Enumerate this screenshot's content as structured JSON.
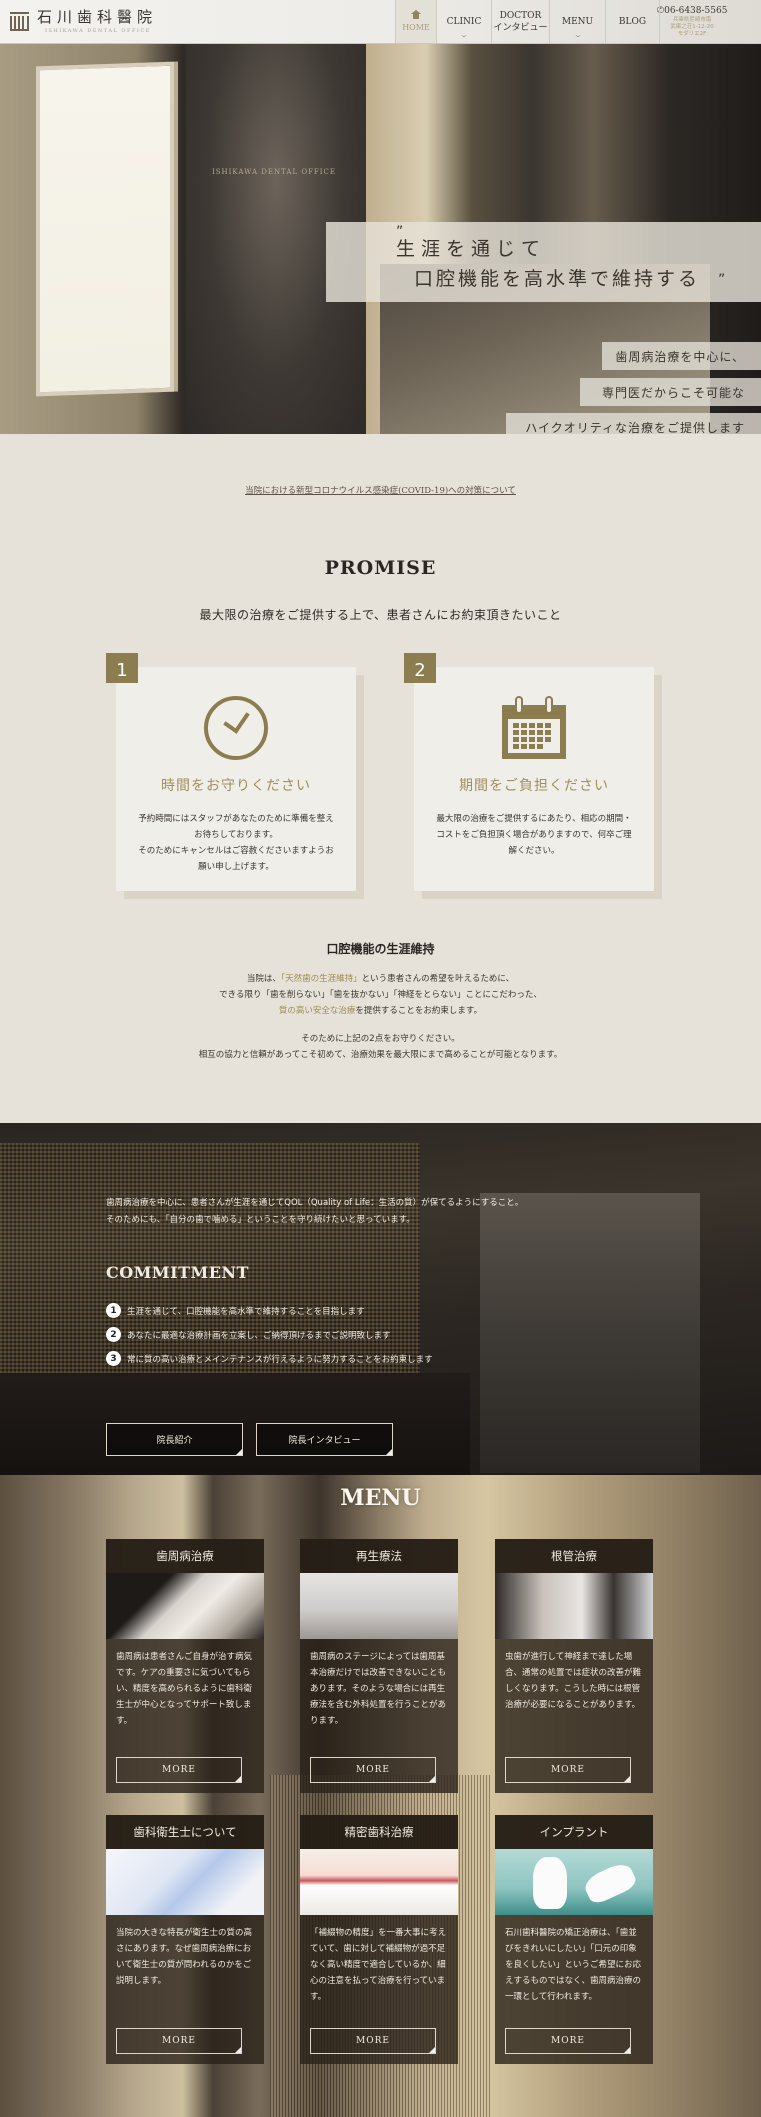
{
  "header": {
    "logo_title": "石川歯科醫院",
    "logo_subtitle": "ISHIKAWA DENTAL OFFICE",
    "nav": [
      {
        "label": "HOME",
        "icon": "home-icon",
        "active": true
      },
      {
        "label": "CLINIC",
        "has_dropdown": true
      },
      {
        "label": "DOCTOR",
        "label2": "インタビュー"
      },
      {
        "label": "MENU",
        "has_dropdown": true
      },
      {
        "label": "BLOG"
      }
    ],
    "phone": "06-6438-5565",
    "address_lines": [
      "兵庫県尼崎市南",
      "武庫之荘1-12-20",
      "モダリエ2F"
    ]
  },
  "hero": {
    "quote_open": "”",
    "quote_line1": "生涯を通じて",
    "quote_line2": "口腔機能を高水準で維持する",
    "quote_close": "”",
    "door_sign": "ISHIKAWA DENTAL OFFICE",
    "taglines": [
      "歯周病治療を中心に、",
      "専門医だからこそ可能な",
      "ハイクオリティな治療をご提供します"
    ]
  },
  "notice": {
    "link": "当院における新型コロナウイルス感染症(COVID-19)への対策について"
  },
  "promise": {
    "title": "PROMISE",
    "subtitle": "最大限の治療をご提供する上で、患者さんにお約束頂きたいこと",
    "cards": [
      {
        "number": "1",
        "icon": "clock-icon",
        "title": "時間をお守りください",
        "body": [
          "予約時間にはスタッフがあなたのために準備を整え",
          "お待ちしております。",
          "そのためにキャンセルはご容赦くださいますようお",
          "願い申し上げます。"
        ]
      },
      {
        "number": "2",
        "icon": "calendar-icon",
        "title": "期間をご負担ください",
        "body": [
          "最大限の治療をご提供するにあたり、相応の期間・",
          "コストをご負担頂く場合がありますので、何卒ご理",
          "解ください。"
        ]
      }
    ],
    "accent_color": "#8b7d4f"
  },
  "oral": {
    "title": "口腔機能の生涯維持",
    "p1_a": "当院は、",
    "p1_hl": "「天然歯の生涯維持」",
    "p1_b": "という患者さんの希望を叶えるために、",
    "p1_line2": "できる限り「歯を削らない」「歯を抜かない」「神経をとらない」ことにこだわった、",
    "p1_hl2": "質の高い安全な治療",
    "p1_c": "を提供することをお約束します。",
    "p2_line1": "そのために上記の2点をお守りください。",
    "p2_line2": "相互の協力と信頼があってこそ初めて、治療効果を最大限にまで高めることが可能となります。"
  },
  "commitment": {
    "intro_line1": "歯周病治療を中心に、患者さんが生涯を通じてQOL（Quality of Life：生活の質）が保てるようにすること。",
    "intro_line2": "そのためにも、「自分の歯で噛める」ということを守り続けたいと思っています。",
    "title": "COMMITMENT",
    "items": [
      {
        "n": "1",
        "text": "生涯を通じて、口腔機能を高水準で維持することを目指します"
      },
      {
        "n": "2",
        "text": "あなたに最適な治療計画を立案し、ご納得頂けるまでご説明致します"
      },
      {
        "n": "3",
        "text": "常に質の高い治療とメインテナンスが行えるように努力することをお約束します"
      }
    ],
    "buttons": [
      "院長紹介",
      "院長インタビュー"
    ]
  },
  "menu": {
    "title": "MENU",
    "more_label": "MORE",
    "items": [
      {
        "title": "歯周病治療",
        "body": "歯周病は患者さんご自身が治す病気です。ケアの重要さに気づいてもらい、精度を高められるように歯科衛生士が中心となってサポート致します。"
      },
      {
        "title": "再生療法",
        "body": "歯周病のステージによっては歯周基本治療だけでは改善できないこともあります。そのような場合には再生療法を含む外科処置を行うことがあります。"
      },
      {
        "title": "根管治療",
        "body": "虫歯が進行して神経まで達した場合、通常の処置では症状の改善が難しくなります。こうした時には根管治療が必要になることがあります。"
      },
      {
        "title": "歯科衛生士について",
        "body": "当院の大きな特長が衛生士の質の高さにあります。なぜ歯周病治療において衛生士の質が問われるのかをご説明します。"
      },
      {
        "title": "精密歯科治療",
        "body": "「補綴物の精度」を一番大事に考えていて、歯に対して補綴物が過不足なく高い精度で適合しているか、細心の注意を払って治療を行っています。"
      },
      {
        "title": "インプラント",
        "body": "石川歯科醫院の矯正治療は、「歯並びをきれいにしたい」「口元の印象を良くしたい」というご希望にお応えするものではなく、歯周病治療の一環として行われます。"
      }
    ]
  }
}
